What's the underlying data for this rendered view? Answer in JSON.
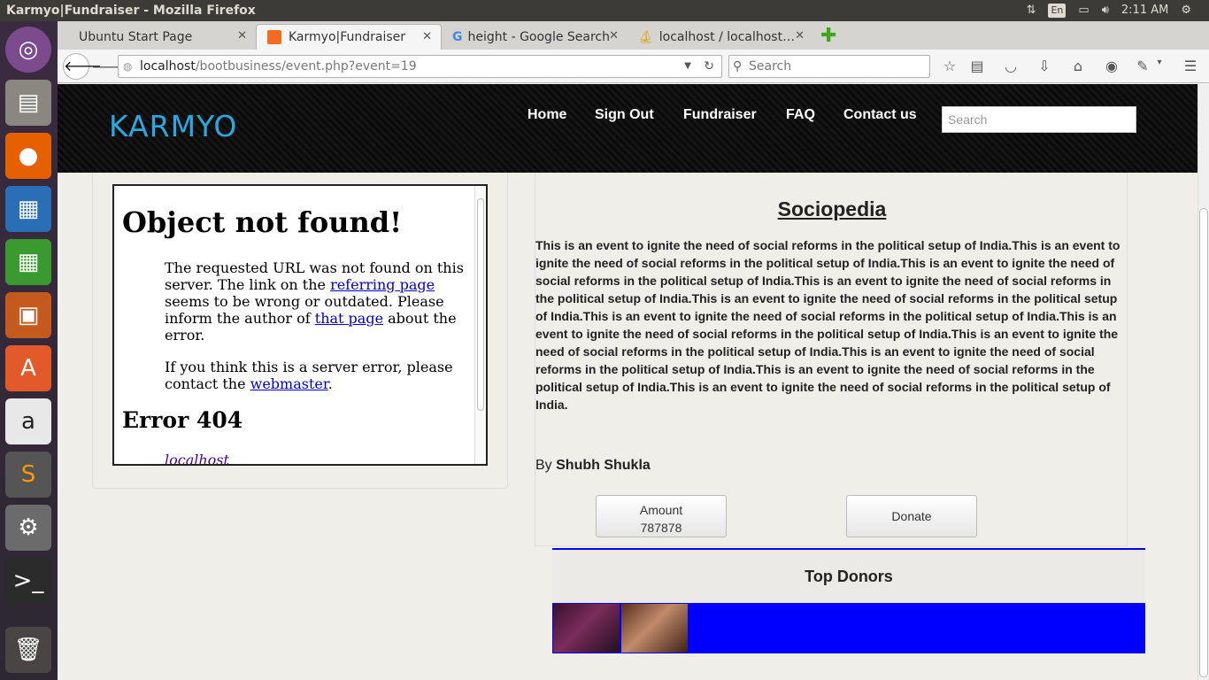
{
  "window": {
    "title": "Karmyo|Fundraiser - Mozilla Firefox"
  },
  "system": {
    "keyboard": "En",
    "time": "2:11 AM"
  },
  "tabs": [
    {
      "label": "Ubuntu Start Page",
      "active": false
    },
    {
      "label": "Karmyo|Fundraiser",
      "active": true
    },
    {
      "label": "height - Google Search",
      "active": false
    },
    {
      "label": "localhost / localhost…",
      "active": false
    }
  ],
  "toolbar": {
    "url_host": "localhost",
    "url_path": "/bootbusiness/event.php?event=19",
    "search_placeholder": "Search"
  },
  "site": {
    "logo": "KARMYO",
    "nav": [
      "Home",
      "Sign Out",
      "Fundraiser",
      "FAQ",
      "Contact us"
    ],
    "search_placeholder": "Search"
  },
  "error_frame": {
    "title": "Object not found!",
    "p1_a": "The requested URL was not found on this server. The link on the ",
    "p1_link1": "referring page",
    "p1_b": " seems to be wrong or outdated. Please inform the author of ",
    "p1_link2": "that page",
    "p1_c": " about the error.",
    "p2_a": "If you think this is a server error, please contact the ",
    "p2_link": "webmaster",
    "p2_b": ".",
    "code": "Error 404",
    "host": "localhost"
  },
  "event": {
    "title": "Sociopedia",
    "description": "This is an event to ignite the need of social reforms in the political setup of India.This is an event to ignite the need of social reforms in the political setup of India.This is an event to ignite the need of social reforms in the political setup of India.This is an event to ignite the need of social reforms in the political setup of India.This is an event to ignite the need of social reforms in the political setup of India.This is an event to ignite the need of social reforms in the political setup of India.This is an event to ignite the need of social reforms in the political setup of India.This is an event to ignite the need of social reforms in the political setup of India.This is an event to ignite the need of social reforms in the political setup of India.This is an event to ignite the need of social reforms in the political setup of India.This is an event to ignite the need of social reforms in the political setup of India.",
    "by_label": "By",
    "author": "Shubh Shukla",
    "amount_label": "Amount",
    "amount_value": "787878",
    "donate_label": "Donate"
  },
  "donors": {
    "title": "Top Donors"
  },
  "colors": {
    "titlebar": "#3c3b37",
    "site_header": "#0a0a0a",
    "logo": "#29a9e0",
    "donor_band": "#0000ff"
  }
}
